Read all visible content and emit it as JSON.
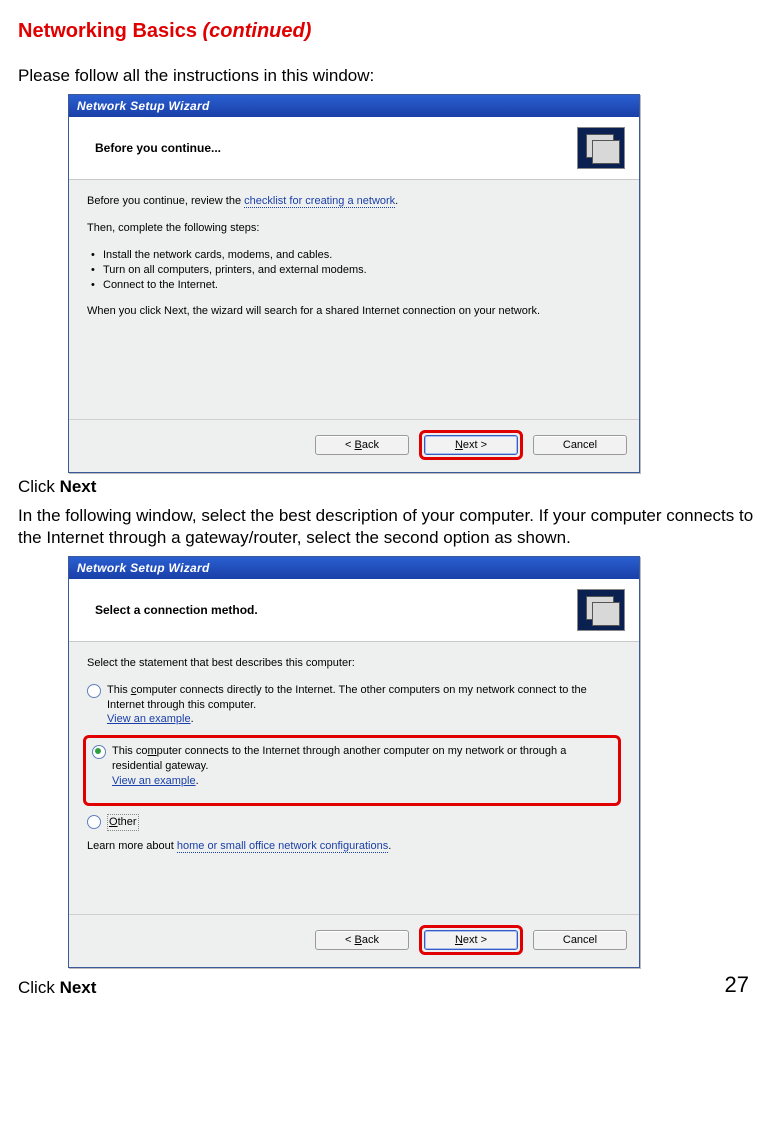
{
  "doc": {
    "title_a": "Networking Basics ",
    "title_b": "(continued)",
    "intro": "Please follow all the instructions in this window:",
    "click_prefix": "Click ",
    "click_next": "Next",
    "mid_para": "In the following window, select the best description of your computer.  If your computer connects to the Internet through a gateway/router, select the second option as shown.",
    "page_number": "27"
  },
  "wizard1": {
    "title": "Network Setup Wizard",
    "heading": "Before you continue...",
    "line_before": "Before you continue, review the ",
    "link_checklist": "checklist for creating a network",
    "line_after": ".",
    "then": "Then, complete the following steps:",
    "steps": [
      "Install the network cards, modems, and cables.",
      "Turn on all computers, printers, and external modems.",
      "Connect to the Internet."
    ],
    "note": "When you click Next, the wizard will search for a shared Internet connection on your network.",
    "buttons": {
      "back_pre": "< ",
      "back_u": "B",
      "back_post": "ack",
      "next_u": "N",
      "next_post": "ext >",
      "cancel": "Cancel"
    }
  },
  "wizard2": {
    "title": "Network Setup Wizard",
    "heading": "Select a connection method.",
    "prompt": "Select the statement that best describes this computer:",
    "opt1_pre": "This ",
    "opt1_u": "c",
    "opt1_post": "omputer connects directly to the Internet. The other computers on my network connect to the Internet through this computer.",
    "opt2_pre": "This co",
    "opt2_u": "m",
    "opt2_post": "puter connects to the Internet through another computer on my network or through a residential gateway.",
    "view_example": "View an example",
    "opt3_u": "O",
    "opt3_post": "ther",
    "learn_pre": "Learn more about ",
    "learn_link": "home or small office network configurations",
    "learn_post": ".",
    "buttons": {
      "back_pre": "< ",
      "back_u": "B",
      "back_post": "ack",
      "next_u": "N",
      "next_post": "ext >",
      "cancel": "Cancel"
    }
  }
}
